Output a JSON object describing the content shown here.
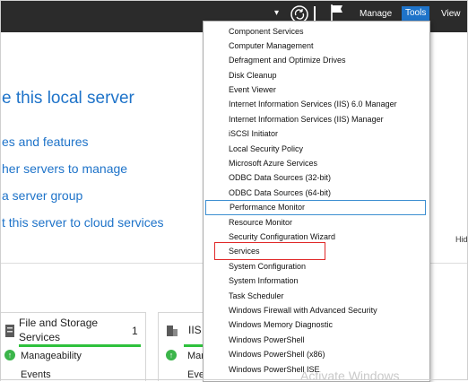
{
  "toolbar": {
    "menus": [
      "Manage",
      "Tools",
      "View"
    ]
  },
  "welcome": {
    "heading": "e this local server",
    "links": [
      "es and features",
      "her servers to manage",
      "a server group",
      "t this server to cloud services"
    ],
    "hide_label": "Hid"
  },
  "tiles": [
    {
      "title_line1": "File and Storage",
      "title_line2": "Services",
      "count": "1",
      "rows": [
        "Manageability",
        "Events"
      ]
    },
    {
      "title_line1": "IIS",
      "rows": [
        "Mar",
        "Eve"
      ]
    }
  ],
  "tools_menu": {
    "items": [
      "Component Services",
      "Computer Management",
      "Defragment and Optimize Drives",
      "Disk Cleanup",
      "Event Viewer",
      "Internet Information Services (IIS) 6.0 Manager",
      "Internet Information Services (IIS) Manager",
      "iSCSI Initiator",
      "Local Security Policy",
      "Microsoft Azure Services",
      "ODBC Data Sources (32-bit)",
      "ODBC Data Sources (64-bit)",
      "Performance Monitor",
      "Resource Monitor",
      "Security Configuration Wizard",
      "Services",
      "System Configuration",
      "System Information",
      "Task Scheduler",
      "Windows Firewall with Advanced Security",
      "Windows Memory Diagnostic",
      "Windows PowerShell",
      "Windows PowerShell (x86)",
      "Windows PowerShell ISE"
    ],
    "hovered_item": "Performance Monitor",
    "annotated_item": "Services",
    "watermark": "Activate Windows"
  },
  "colors": {
    "topbar": "#2b2b2b",
    "accent": "#1e73c9",
    "status_ok": "#2ec13c",
    "annotation": "#e02828"
  },
  "icons": [
    "dropdown-caret-icon",
    "refresh-icon",
    "notifications-flag-icon",
    "server-role-icon",
    "iis-icon",
    "status-ok-icon"
  ]
}
